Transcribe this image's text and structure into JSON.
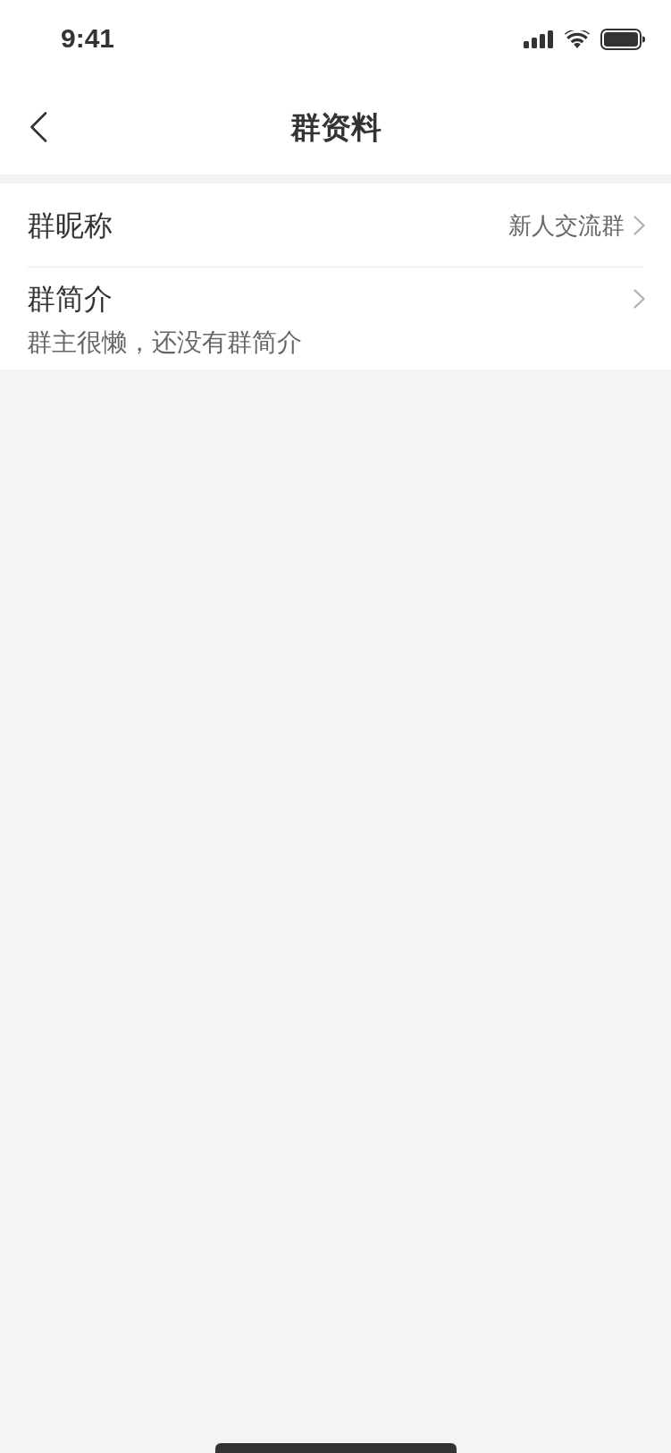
{
  "status_bar": {
    "time": "9:41"
  },
  "nav_bar": {
    "title": "群资料"
  },
  "settings": [
    {
      "kind": "value",
      "label": "群昵称",
      "value": "新人交流群"
    },
    {
      "kind": "description",
      "label": "群简介",
      "description": "群主很懒，还没有群简介"
    }
  ]
}
